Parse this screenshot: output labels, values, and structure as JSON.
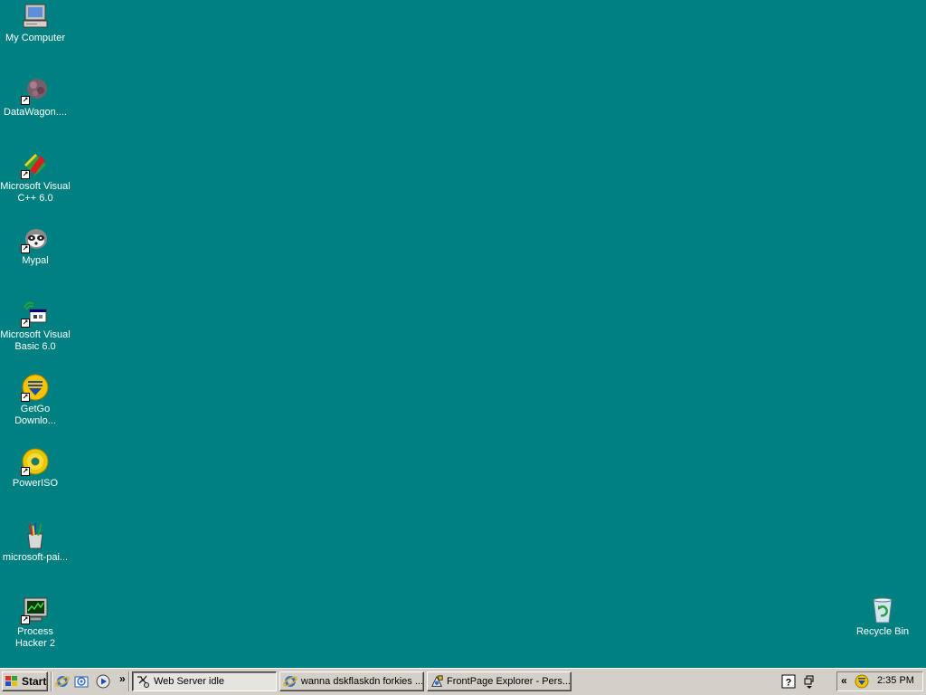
{
  "desktop": {
    "background_color": "#008080",
    "icons": [
      {
        "label": "My Computer",
        "icon": "my-computer-icon"
      },
      {
        "label": "DataWagon....",
        "icon": "datawagon-icon"
      },
      {
        "label": "Microsoft Visual\nC++ 6.0",
        "icon": "visual-cpp-icon"
      },
      {
        "label": "Mypal",
        "icon": "mypal-raccoon-icon"
      },
      {
        "label": "Microsoft Visual\nBasic 6.0",
        "icon": "visual-basic-icon"
      },
      {
        "label": "GetGo\nDownlo...",
        "icon": "getgo-download-icon"
      },
      {
        "label": "PowerISO",
        "icon": "poweriso-disc-icon"
      },
      {
        "label": "microsoft-pai...",
        "icon": "paint-icon"
      },
      {
        "label": "Process\nHacker 2",
        "icon": "process-hacker-icon"
      }
    ],
    "recycle_bin": {
      "label": "Recycle Bin",
      "icon": "recycle-bin-icon"
    }
  },
  "taskbar": {
    "start_label": "Start",
    "quick_launch": [
      "internet-explorer-icon",
      "outlook-express-icon",
      "media-player-icon"
    ],
    "chevron": "»",
    "tasks": [
      {
        "label": "Web Server idle",
        "icon": "web-server-icon",
        "pressed": true
      },
      {
        "label": "wanna dskflaskdn forkies ...",
        "icon": "internet-explorer-icon",
        "pressed": false
      },
      {
        "label": "FrontPage Explorer - Pers...",
        "icon": "frontpage-icon",
        "pressed": false
      }
    ],
    "tray": {
      "expand": "«",
      "clock": "2:35 PM"
    }
  }
}
